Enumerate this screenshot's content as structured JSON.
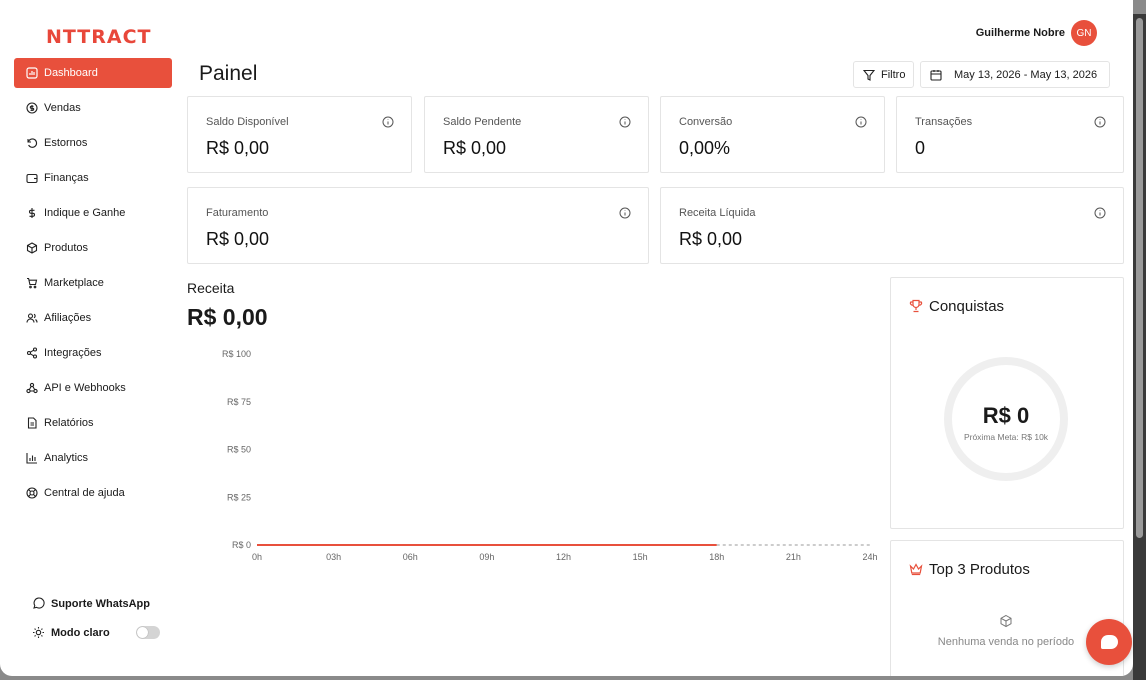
{
  "brand": {
    "logo": "NTTRACT",
    "accent": "#e8503c"
  },
  "user": {
    "name": "Guilherme Nobre",
    "initials": "GN"
  },
  "sidebar": {
    "items": [
      {
        "label": "Dashboard",
        "icon": "chart-icon",
        "active": true
      },
      {
        "label": "Vendas",
        "icon": "dollar-circle-icon"
      },
      {
        "label": "Estornos",
        "icon": "undo-icon"
      },
      {
        "label": "Finanças",
        "icon": "wallet-icon"
      },
      {
        "label": "Indique e Ganhe",
        "icon": "dollar-icon"
      },
      {
        "label": "Produtos",
        "icon": "box-icon"
      },
      {
        "label": "Marketplace",
        "icon": "cart-icon"
      },
      {
        "label": "Afiliações",
        "icon": "users-icon"
      },
      {
        "label": "Integrações",
        "icon": "share-icon"
      },
      {
        "label": "API e Webhooks",
        "icon": "webhook-icon"
      },
      {
        "label": "Relatórios",
        "icon": "report-icon"
      },
      {
        "label": "Analytics",
        "icon": "bar-chart-icon"
      },
      {
        "label": "Central de ajuda",
        "icon": "lifebuoy-icon"
      }
    ],
    "whatsapp_label": "Suporte WhatsApp",
    "theme_label": "Modo claro",
    "theme_toggle_on": false
  },
  "header": {
    "title": "Painel",
    "filter_label": "Filtro",
    "date_range": "May 13, 2026 - May 13, 2026"
  },
  "stats": {
    "saldo_disponivel": {
      "label": "Saldo Disponível",
      "value": "R$ 0,00"
    },
    "saldo_pendente": {
      "label": "Saldo Pendente",
      "value": "R$ 0,00"
    },
    "conversao": {
      "label": "Conversão",
      "value": "0,00%"
    },
    "transacoes": {
      "label": "Transações",
      "value": "0"
    },
    "faturamento": {
      "label": "Faturamento",
      "value": "R$ 0,00"
    },
    "receita_liquida": {
      "label": "Receita Líquida",
      "value": "R$ 0,00"
    }
  },
  "revenue": {
    "title": "Receita",
    "total": "R$ 0,00"
  },
  "chart_data": {
    "type": "line",
    "x": [
      "0h",
      "03h",
      "06h",
      "09h",
      "12h",
      "15h",
      "18h",
      "21h",
      "24h"
    ],
    "y_ticks": [
      "R$ 0",
      "R$ 25",
      "R$ 50",
      "R$ 75",
      "R$ 100"
    ],
    "ylim": [
      0,
      100
    ],
    "series": [
      {
        "values": [
          0,
          0,
          0,
          0,
          0,
          0,
          0
        ],
        "style": "solid",
        "color": "#e8503c"
      },
      {
        "values": [
          0,
          0,
          0
        ],
        "x_start": "18h",
        "style": "dashed",
        "color": "#9a9a9a"
      }
    ]
  },
  "achievements": {
    "title": "Conquistas",
    "value": "R$ 0",
    "next_goal": "Próxima Meta: R$ 10k",
    "progress": 0
  },
  "top_products": {
    "title": "Top 3 Produtos",
    "empty_text": "Nenhuma venda no período"
  }
}
